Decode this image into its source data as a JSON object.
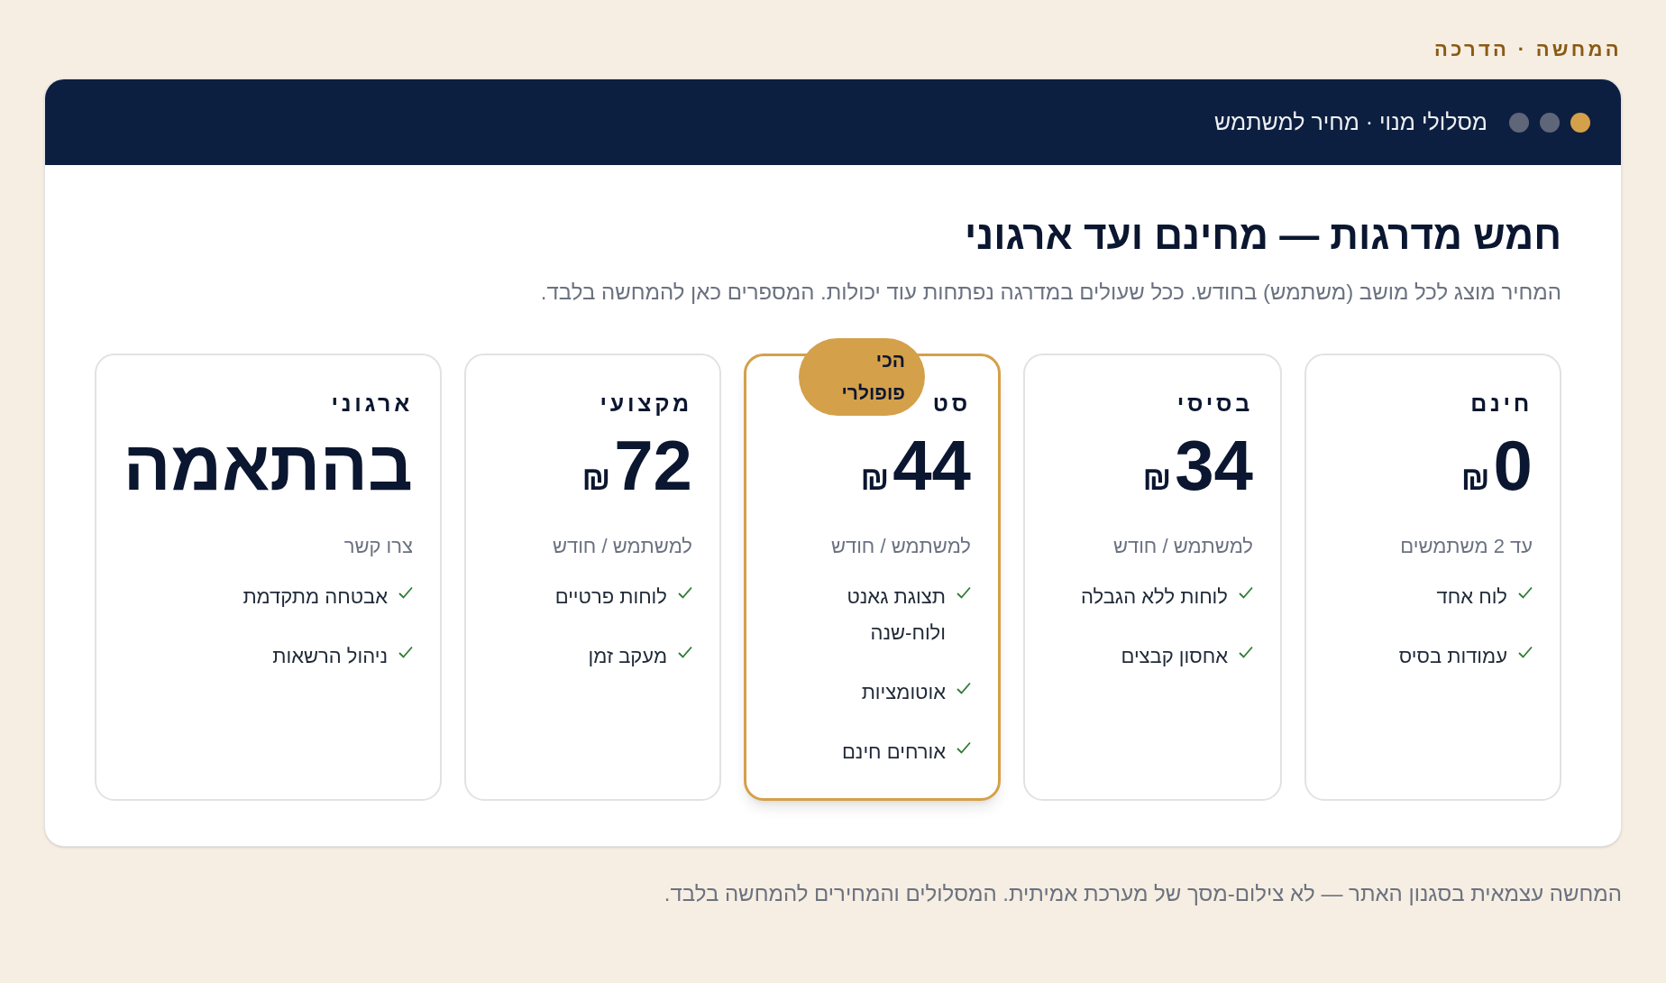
{
  "breadcrumb": "המחשה · הדרכה",
  "window": {
    "title": "מסלולי מנוי · מחיר למשתמש"
  },
  "heading": "חמש מדרגות — מחינם ועד ארגוני",
  "subtitle": "המחיר מוצג לכל מושב (משתמש) בחודש. ככל שעולים במדרגה נפתחות עוד יכולות. המספרים כאן להמחשה בלבד.",
  "plans": [
    {
      "name": "חינם",
      "price": "0",
      "currency": "₪",
      "period": "עד 2 משתמשים",
      "featured": false,
      "features": [
        "לוח אחד",
        "עמודות בסיס"
      ]
    },
    {
      "name": "בסיסי",
      "price": "34",
      "currency": "₪",
      "period": "למשתמש / חודש",
      "featured": false,
      "features": [
        "לוחות ללא הגבלה",
        "אחסון קבצים"
      ]
    },
    {
      "name": "סט",
      "price": "44",
      "currency": "₪",
      "period": "למשתמש / חודש",
      "featured": true,
      "badge": "הכי פופולרי",
      "features": [
        "תצוגת גאנט ולוח-שנה",
        "אוטומציות",
        "אורחים חינם"
      ]
    },
    {
      "name": "מקצועי",
      "price": "72",
      "currency": "₪",
      "period": "למשתמש / חודש",
      "featured": false,
      "features": [
        "לוחות פרטיים",
        "מעקב זמן"
      ]
    },
    {
      "name": "ארגוני",
      "price": "בהתאמה",
      "period": "צרו קשר",
      "featured": false,
      "features": [
        "אבטחה מתקדמת",
        "ניהול הרשאות"
      ]
    }
  ],
  "footer": "המחשה עצמאית בסגנון האתר — לא צילום-מסך של מערכת אמיתית. המסלולים והמחירים להמחשה בלבד."
}
